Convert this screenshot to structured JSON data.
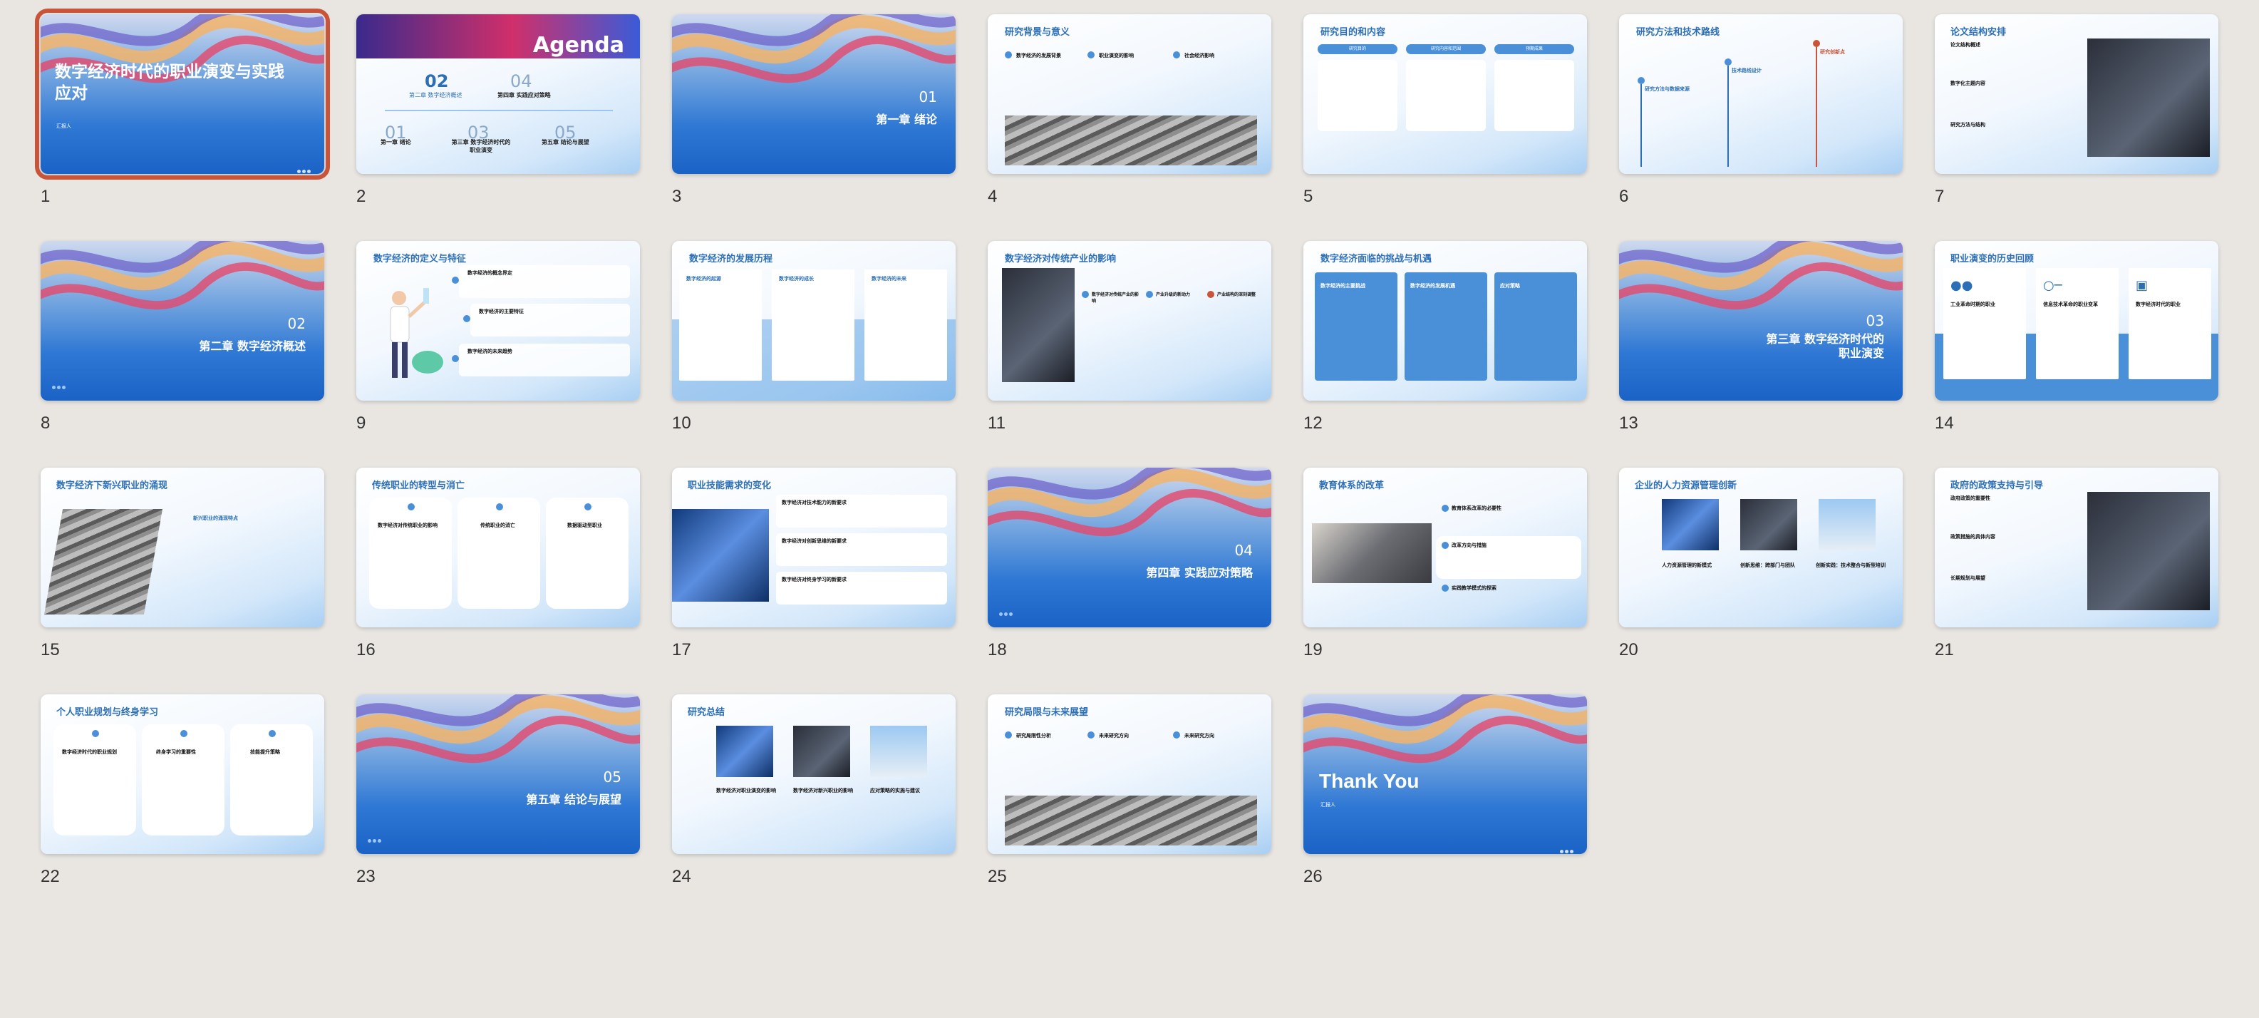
{
  "slide_numbers": [
    "1",
    "2",
    "3",
    "4",
    "5",
    "6",
    "7",
    "8",
    "9",
    "10",
    "11",
    "12",
    "13",
    "14",
    "15",
    "16",
    "17",
    "18",
    "19",
    "20",
    "21",
    "22",
    "23",
    "24",
    "25",
    "26"
  ],
  "selected_slide": "1",
  "colors": {
    "accent": "#2c6fb7",
    "selection": "#c8553a",
    "background": "#e9e6e2",
    "card_blue": "#4a90d9"
  },
  "slides": {
    "s1": {
      "title": "数字经济时代的职业演变与实践应对",
      "presenter": "汇报人"
    },
    "s2": {
      "title": "Agenda",
      "items": [
        {
          "num": "01",
          "label": "第一章 绪论"
        },
        {
          "num": "02",
          "label": "第二章 数字经济概述"
        },
        {
          "num": "03",
          "label": "第三章 数字经济时代的职业演变"
        },
        {
          "num": "04",
          "label": "第四章 实践应对策略"
        },
        {
          "num": "05",
          "label": "第五章 结论与展望"
        }
      ]
    },
    "s3": {
      "num": "01",
      "title": "第一章 绪论"
    },
    "s4": {
      "title": "研究背景与意义",
      "items": [
        "数字经济的发展背景",
        "职业演变的影响",
        "社会经济影响"
      ]
    },
    "s5": {
      "title": "研究目的和内容",
      "pills": [
        "研究目的",
        "研究内容和范围",
        "预期成果"
      ]
    },
    "s6": {
      "title": "研究方法和技术路线",
      "items": [
        "研究方法与数据来源",
        "技术路线设计",
        "研究创新点"
      ]
    },
    "s7": {
      "title": "论文结构安排",
      "items": [
        "论文结构概述",
        "数字化主题内容",
        "研究方法与结构"
      ]
    },
    "s8": {
      "num": "02",
      "title": "第二章 数字经济概述"
    },
    "s9": {
      "title": "数字经济的定义与特征",
      "items": [
        "数字经济的概念界定",
        "数字经济的主要特征",
        "数字经济的未来趋势"
      ]
    },
    "s10": {
      "title": "数字经济的发展历程",
      "cols": [
        "数字经济的起源",
        "数字经济的成长",
        "数字经济的未来"
      ]
    },
    "s11": {
      "title": "数字经济对传统产业的影响",
      "items": [
        "数字经济对传统产业的影响",
        "产业升级的新动力",
        "产业结构的深刻调整"
      ]
    },
    "s12": {
      "title": "数字经济面临的挑战与机遇",
      "cards": [
        "数字经济的主要挑战",
        "数字经济的发展机遇",
        "应对策略"
      ]
    },
    "s13": {
      "num": "03",
      "title": "第三章 数字经济时代的职业演变"
    },
    "s14": {
      "title": "职业演变的历史回顾",
      "items": [
        "工业革命时期的职业",
        "信息技术革命的职业变革",
        "数字经济时代的职业"
      ]
    },
    "s15": {
      "title": "数字经济下新兴职业的涌现",
      "subtitle": "新兴职业的涌现特点"
    },
    "s16": {
      "title": "传统职业的转型与消亡",
      "items": [
        "数字经济对传统职业的影响",
        "传统职业的消亡",
        "数据驱动型职业"
      ]
    },
    "s17": {
      "title": "职业技能需求的变化",
      "items": [
        "数字经济对技术能力的新要求",
        "数字经济对创新思维的新要求",
        "数字经济对终身学习的新要求"
      ]
    },
    "s18": {
      "num": "04",
      "title": "第四章 实践应对策略"
    },
    "s19": {
      "title": "教育体系的改革",
      "items": [
        "教育体系改革的必要性",
        "改革方向与措施",
        "实践教学模式的探索"
      ]
    },
    "s20": {
      "title": "企业的人力资源管理创新",
      "items": [
        "人力资源管理的新模式",
        "创新思维：跨部门与团队",
        "创新实践：技术整合与新型培训"
      ]
    },
    "s21": {
      "title": "政府的政策支持与引导",
      "items": [
        "政府政策的重要性",
        "政策措施的具体内容",
        "长期规划与展望"
      ]
    },
    "s22": {
      "title": "个人职业规划与终身学习",
      "items": [
        "数字经济时代的职业规划",
        "终身学习的重要性",
        "技能提升策略"
      ]
    },
    "s23": {
      "num": "05",
      "title": "第五章 结论与展望"
    },
    "s24": {
      "title": "研究总结",
      "items": [
        "数字经济对职业演变的影响",
        "数字经济对新兴职业的影响",
        "应对策略的实施与建议"
      ]
    },
    "s25": {
      "title": "研究局限与未来展望",
      "items": [
        "研究局限性分析",
        "未来研究方向",
        "未来研究方向"
      ]
    },
    "s26": {
      "title": "Thank You",
      "presenter": "汇报人"
    }
  }
}
